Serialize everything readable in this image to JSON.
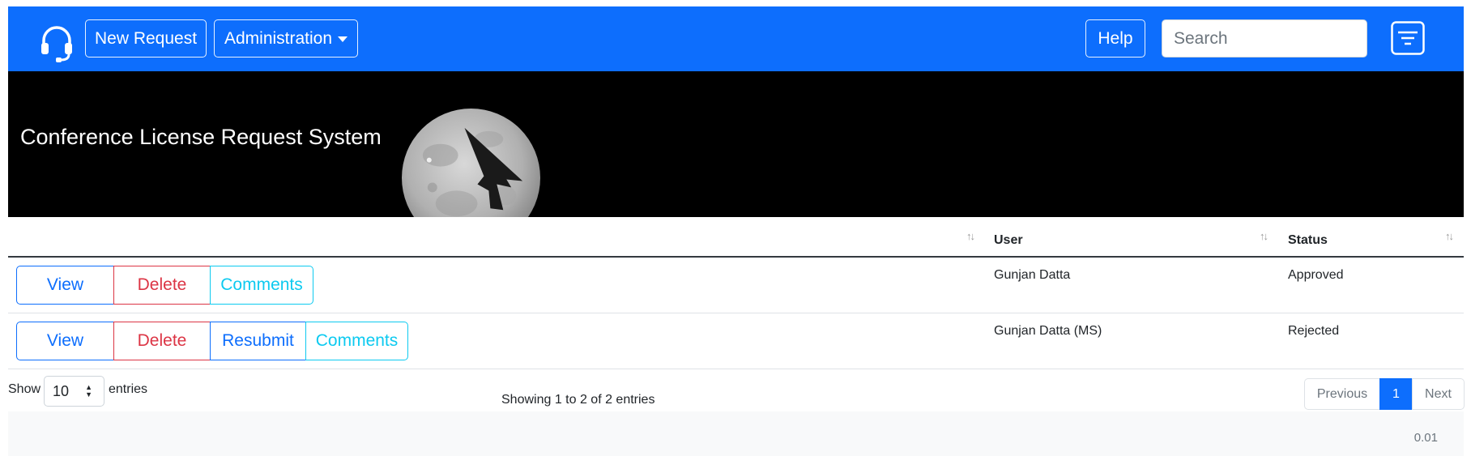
{
  "navbar": {
    "logo_icon": "headset-icon",
    "new_request_label": "New Request",
    "administration_label": "Administration",
    "help_label": "Help",
    "search_placeholder": "Search",
    "filter_icon": "filter-lines-icon",
    "brand_color": "#0d6efd"
  },
  "banner": {
    "title": "Conference License Request System",
    "image": "moon-with-stealth-bomber"
  },
  "table": {
    "columns": [
      "",
      "User",
      "Status"
    ],
    "rows": [
      {
        "actions": [
          "View",
          "Delete",
          "Comments"
        ],
        "user": "Gunjan Datta",
        "status": "Approved"
      },
      {
        "actions": [
          "View",
          "Delete",
          "Resubmit",
          "Comments"
        ],
        "user": "Gunjan Datta (MS)",
        "status": "Rejected"
      }
    ]
  },
  "length": {
    "show_label": "Show",
    "value": "10",
    "entries_label": "entries"
  },
  "info": "Showing 1 to 2 of 2 entries",
  "pagination": {
    "previous": "Previous",
    "current": "1",
    "next": "Next"
  },
  "footer": {
    "version": "0.01"
  }
}
